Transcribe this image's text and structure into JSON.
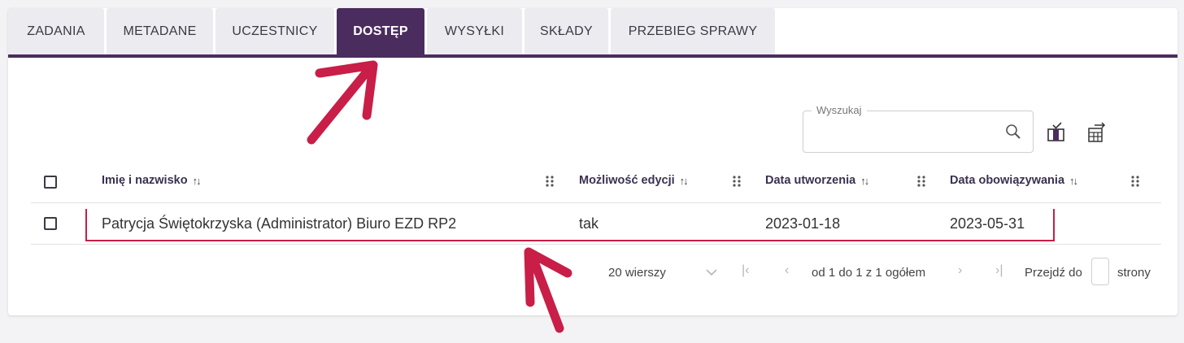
{
  "tabs": [
    {
      "label": "ZADANIA",
      "active": false
    },
    {
      "label": "METADANE",
      "active": false
    },
    {
      "label": "UCZESTNICY",
      "active": false
    },
    {
      "label": "DOSTĘP",
      "active": true
    },
    {
      "label": "WYSYŁKI",
      "active": false
    },
    {
      "label": "SKŁADY",
      "active": false
    },
    {
      "label": "PRZEBIEG SPRAWY",
      "active": false
    }
  ],
  "search": {
    "legend": "Wyszukaj",
    "value": ""
  },
  "toolbar": {
    "icons": [
      "column-chooser-icon",
      "export-table-icon"
    ]
  },
  "table": {
    "columns": [
      "Imię i nazwisko",
      "Możliwość edycji",
      "Data utworzenia",
      "Data obowiązywania"
    ],
    "sort_glyph": "↑↓",
    "rows": [
      {
        "name": "Patrycja Świętokrzyska (Administrator) Biuro EZD RP2",
        "edit": "tak",
        "created": "2023-01-18",
        "valid_until": "2023-05-31",
        "highlighted": true
      }
    ]
  },
  "pagination": {
    "rows_per_page": "20 wierszy",
    "range_text": "od 1 do 1 z 1 ogółem",
    "goto_label": "Przejdź do",
    "goto_suffix": "strony",
    "goto_value": ""
  },
  "colors": {
    "accent": "#4b2c5e",
    "annotation": "#c81e47"
  }
}
